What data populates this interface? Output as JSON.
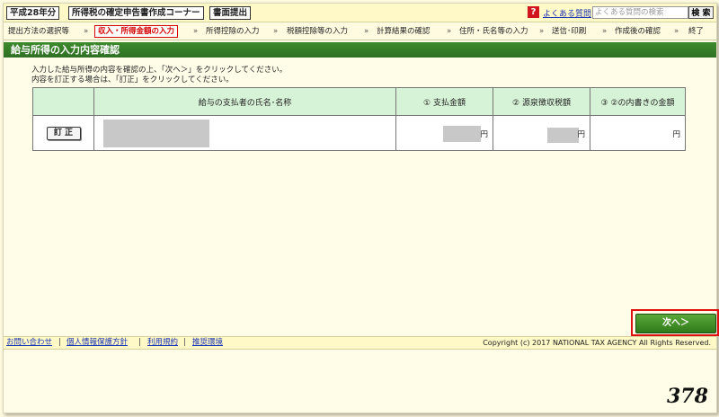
{
  "header": {
    "year_tag": "平成28年分",
    "corner_tag": "所得税の確定申告書作成コーナー",
    "submit_tag": "書面提出",
    "help_icon": "question-icon",
    "faq_link": "よくある質問",
    "search_placeholder": "よくある質問の検索",
    "search_button": "検 索"
  },
  "steps": [
    {
      "label": "提出方法の選択等"
    },
    {
      "label": "収入・所得金額の入力",
      "current": true
    },
    {
      "label": "所得控除の入力"
    },
    {
      "label": "税額控除等の入力"
    },
    {
      "label": "計算結果の確認"
    },
    {
      "label": "住所・氏名等の入力"
    },
    {
      "label": "送信･印刷"
    },
    {
      "label": "作成後の確認"
    },
    {
      "label": "終了"
    }
  ],
  "step_separator": "»",
  "page_title": "給与所得の入力内容確認",
  "instructions": [
    "入力した給与所得の内容を確認の上、「次へ＞」をクリックしてください。",
    "内容を訂正する場合は、「訂正」をクリックしてください。"
  ],
  "table": {
    "headers": [
      "",
      "給与の支払者の氏名･名称",
      "① 支払金額",
      "② 源泉徴収税額",
      "③ ②の内書きの金額"
    ],
    "rows": [
      {
        "edit_label": "訂 正",
        "unit1": "円",
        "unit2": "円",
        "unit3": "円"
      }
    ]
  },
  "next_button": "次へ＞",
  "footer": {
    "links": [
      "お問い合わせ",
      "個人情報保護方針",
      "利用規約",
      "推奨環境"
    ],
    "separator": "|",
    "copyright": "Copyright (c) 2017 NATIONAL TAX AGENCY All Rights Reserved."
  },
  "page_number": "378"
}
